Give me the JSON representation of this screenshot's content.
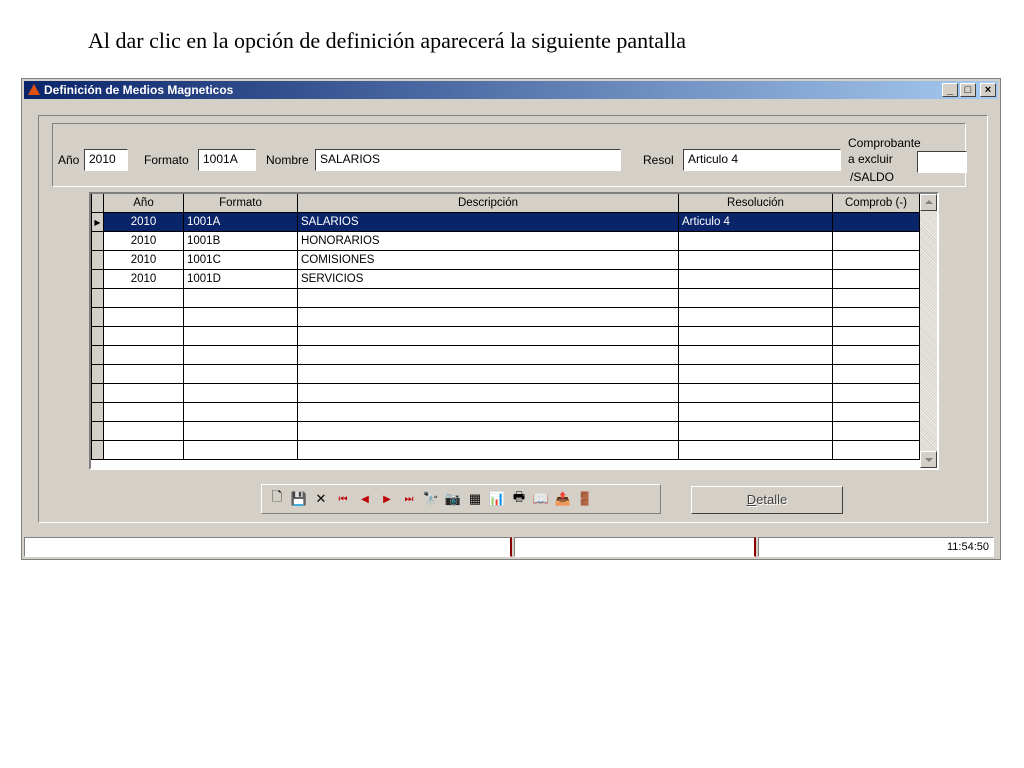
{
  "caption": "Al dar clic en la opción de definición aparecerá la siguiente pantalla",
  "window": {
    "title": "Definición de Medios Magneticos",
    "controls": [
      "_",
      "□",
      "×"
    ]
  },
  "filters": {
    "anio_label": "Año",
    "anio_value": "2010",
    "formato_label": "Formato",
    "formato_value": "1001A",
    "nombre_label": "Nombre",
    "nombre_value": "SALARIOS",
    "resol_label": "Resol",
    "resol_value": "Articulo 4",
    "comprobante_label_1": "Comprobante",
    "comprobante_label_2": "a excluir",
    "comprobante_label_3": "/SALDO",
    "comprobante_value": ""
  },
  "grid": {
    "columns": [
      "Año",
      "Formato",
      "Descripción",
      "Resolución",
      "Comprob (-)"
    ],
    "rows": [
      [
        "2010",
        "1001A",
        "SALARIOS",
        "Articulo 4",
        ""
      ],
      [
        "2010",
        "1001B",
        "HONORARIOS",
        "",
        ""
      ],
      [
        "2010",
        "1001C",
        "COMISIONES",
        "",
        ""
      ],
      [
        "2010",
        "1001D",
        "SERVICIOS",
        "",
        ""
      ]
    ],
    "selected_row": 0,
    "total_rows": 13
  },
  "toolbar": {
    "icons": [
      "new-icon",
      "save-icon",
      "delete-icon",
      "first-record-icon",
      "prev-record-icon",
      "next-record-icon",
      "last-record-icon",
      "find-icon",
      "camera-icon",
      "table-icon",
      "chart-icon",
      "print-icon",
      "export-icon",
      "import-icon",
      "exit-icon"
    ]
  },
  "detalle_button": {
    "prefix": "D",
    "rest": "etalle"
  },
  "status": {
    "clock": "11:54:50"
  }
}
